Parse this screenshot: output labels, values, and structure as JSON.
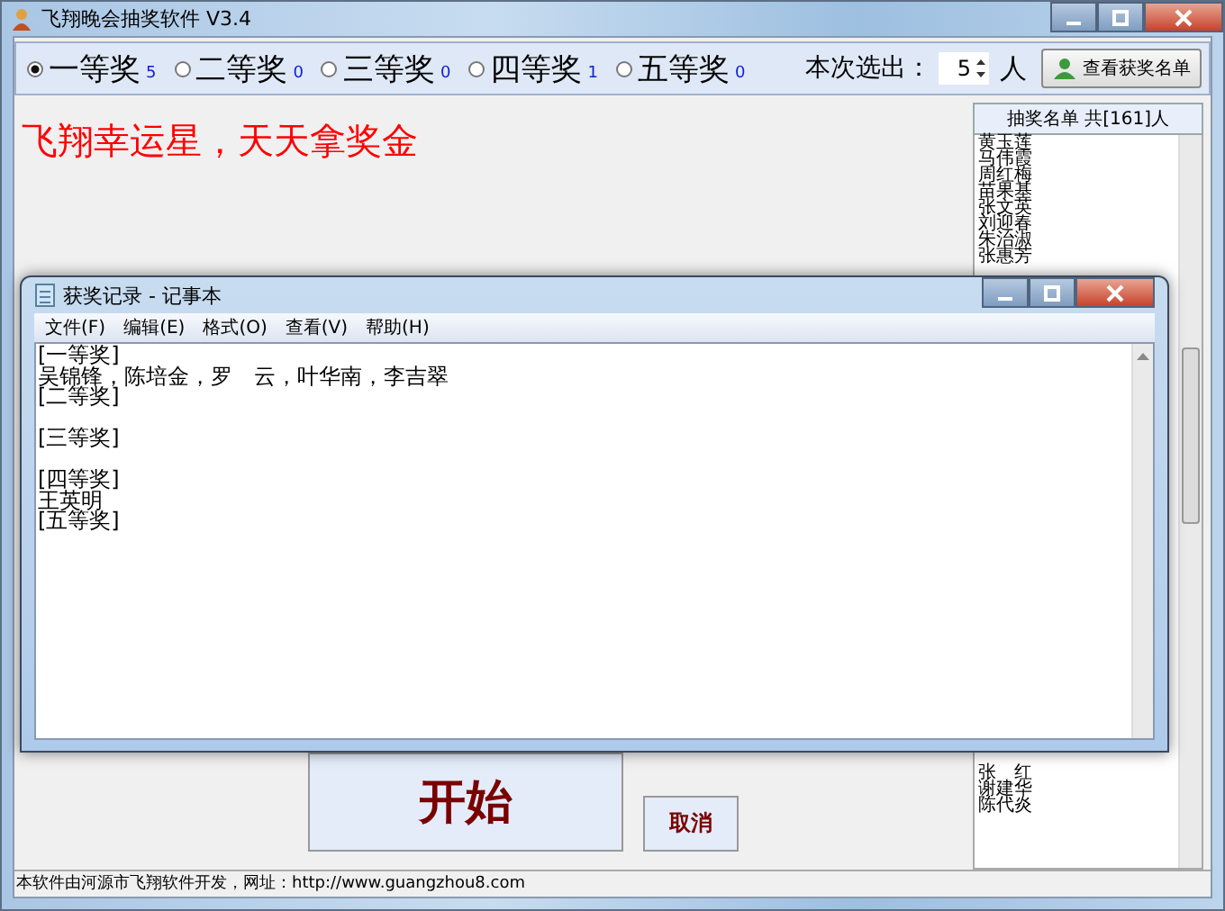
{
  "window": {
    "title": "飞翔晚会抽奖软件 V3.4"
  },
  "prizes": [
    {
      "label": "一等奖",
      "count": "5",
      "selected": true
    },
    {
      "label": "二等奖",
      "count": "0",
      "selected": false
    },
    {
      "label": "三等奖",
      "count": "0",
      "selected": false
    },
    {
      "label": "四等奖",
      "count": "1",
      "selected": false
    },
    {
      "label": "五等奖",
      "count": "0",
      "selected": false
    }
  ],
  "draw_count": {
    "label": "本次选出：",
    "value": "5",
    "unit": "人"
  },
  "view_winners_button": "查看获奖名单",
  "slogan": "飞翔幸运星，天天拿奖金",
  "roster": {
    "header": "抽奖名单 共[161]人",
    "names_above": [
      "黄玉莲",
      "马伟霞",
      "周红梅",
      "苗果基",
      "张文英",
      "刘迎春",
      "朱治淑",
      "张惠芳"
    ],
    "names_below": [
      "张　红",
      "谢建华",
      "陈代炎"
    ]
  },
  "notepad": {
    "title": "获奖记录 - 记事本",
    "menu": [
      "文件(F)",
      "编辑(E)",
      "格式(O)",
      "查看(V)",
      "帮助(H)"
    ],
    "sections": [
      {
        "heading": "[一等奖]",
        "winners": "吴锦锋，陈培金，罗　云，叶华南，李吉翠"
      },
      {
        "heading": "[二等奖]"
      },
      {
        "heading": "[三等奖]"
      },
      {
        "heading": "[四等奖]",
        "winners": "王英明"
      },
      {
        "heading": "[五等奖]"
      }
    ]
  },
  "start_button": "开始",
  "cancel_button": "取消",
  "status_bar": "本软件由河源市飞翔软件开发，网址：http://www.guangzhou8.com"
}
